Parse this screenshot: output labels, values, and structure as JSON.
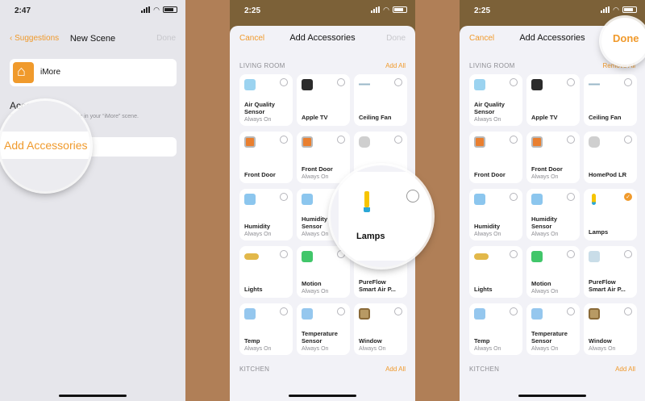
{
  "screen1": {
    "time": "2:47",
    "nav": {
      "back": "Suggestions",
      "title": "New Scene",
      "done": "Done"
    },
    "home_name": "iMore",
    "accessories_header": "Accessories",
    "accessories_sub": "Select accessories to include in your “iMore” scene.",
    "add_accessories": "Add Accessories"
  },
  "screen2": {
    "time": "2:25",
    "nav": {
      "cancel": "Cancel",
      "title": "Add Accessories",
      "done": "Done"
    },
    "section_living": "LIVING ROOM",
    "add_all": "Add All",
    "section_kitchen": "KITCHEN",
    "kitchen_add_all": "Add All",
    "tiles": [
      {
        "name": "Air Quality Sensor",
        "status": "Always On",
        "icon": "air-quality-icon",
        "selected": false
      },
      {
        "name": "Apple TV",
        "status": "",
        "icon": "apple-tv-icon",
        "selected": false
      },
      {
        "name": "Ceiling Fan",
        "status": "",
        "icon": "ceiling-fan-icon",
        "selected": false
      },
      {
        "name": "Front Door",
        "status": "",
        "icon": "door-icon",
        "selected": false
      },
      {
        "name": "Front Door",
        "status": "Always On",
        "icon": "door-icon",
        "selected": false
      },
      {
        "name": "HomePod LR",
        "status": "",
        "icon": "homepod-icon",
        "selected": false
      },
      {
        "name": "Humidity",
        "status": "Always On",
        "icon": "humidity-icon",
        "selected": false
      },
      {
        "name": "Humidity Sensor",
        "status": "Always On",
        "icon": "humidity-icon",
        "selected": false
      },
      {
        "name": "Lamps",
        "status": "",
        "icon": "lamp-icon",
        "selected": false
      },
      {
        "name": "Lights",
        "status": "",
        "icon": "lights-icon",
        "selected": false
      },
      {
        "name": "Motion",
        "status": "Always On",
        "icon": "motion-icon",
        "selected": false
      },
      {
        "name": "PureFlow Smart Air P...",
        "status": "",
        "icon": "air-purifier-icon",
        "selected": false
      },
      {
        "name": "Temp",
        "status": "Always On",
        "icon": "thermometer-icon",
        "selected": false
      },
      {
        "name": "Temperature Sensor",
        "status": "Always On",
        "icon": "thermometer-icon",
        "selected": false
      },
      {
        "name": "Window",
        "status": "Always On",
        "icon": "window-icon",
        "selected": false
      }
    ],
    "magnified_label": "Lamps"
  },
  "screen3": {
    "time": "2:25",
    "nav": {
      "cancel": "Cancel",
      "title": "Add Accessories",
      "done": "Done"
    },
    "section_living": "LIVING ROOM",
    "remove_all": "Remove All",
    "section_kitchen": "KITCHEN",
    "kitchen_add_all": "Add All",
    "tiles": [
      {
        "name": "Air Quality Sensor",
        "status": "Always On",
        "icon": "air-quality-icon",
        "selected": false
      },
      {
        "name": "Apple TV",
        "status": "",
        "icon": "apple-tv-icon",
        "selected": false
      },
      {
        "name": "Ceiling Fan",
        "status": "",
        "icon": "ceiling-fan-icon",
        "selected": false
      },
      {
        "name": "Front Door",
        "status": "",
        "icon": "door-icon",
        "selected": false
      },
      {
        "name": "Front Door",
        "status": "Always On",
        "icon": "door-icon",
        "selected": false
      },
      {
        "name": "HomePod LR",
        "status": "",
        "icon": "homepod-icon",
        "selected": false
      },
      {
        "name": "Humidity",
        "status": "Always On",
        "icon": "humidity-icon",
        "selected": false
      },
      {
        "name": "Humidity Sensor",
        "status": "Always On",
        "icon": "humidity-icon",
        "selected": false
      },
      {
        "name": "Lamps",
        "status": "",
        "icon": "lamp-icon",
        "selected": true
      },
      {
        "name": "Lights",
        "status": "",
        "icon": "lights-icon",
        "selected": false
      },
      {
        "name": "Motion",
        "status": "Always On",
        "icon": "motion-icon",
        "selected": false
      },
      {
        "name": "PureFlow Smart Air P...",
        "status": "",
        "icon": "air-purifier-icon",
        "selected": false
      },
      {
        "name": "Temp",
        "status": "Always On",
        "icon": "thermometer-icon",
        "selected": false
      },
      {
        "name": "Temperature Sensor",
        "status": "Always On",
        "icon": "thermometer-icon",
        "selected": false
      },
      {
        "name": "Window",
        "status": "Always On",
        "icon": "window-icon",
        "selected": false
      }
    ]
  },
  "colors": {
    "accent": "#f09a2c",
    "background": "#f2f2f7",
    "wood": "#b07f57"
  }
}
